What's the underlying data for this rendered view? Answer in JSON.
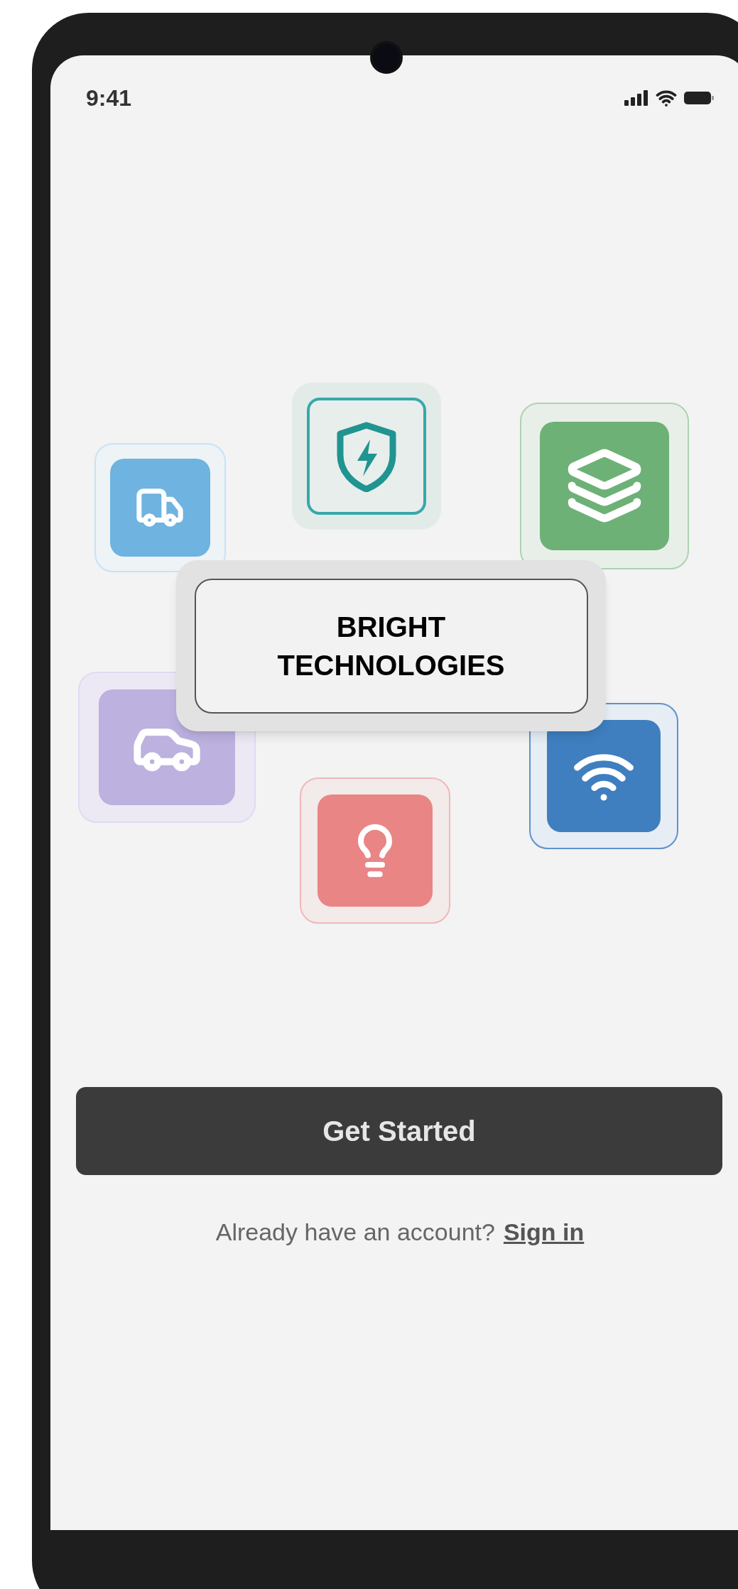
{
  "status_bar": {
    "time": "9:41"
  },
  "brand": {
    "title": "BRIGHT TECHNOLOGIES"
  },
  "primary_button": {
    "label": "Get Started"
  },
  "sign_in_prompt": {
    "text": "Already have an account?",
    "link": "Sign in"
  }
}
